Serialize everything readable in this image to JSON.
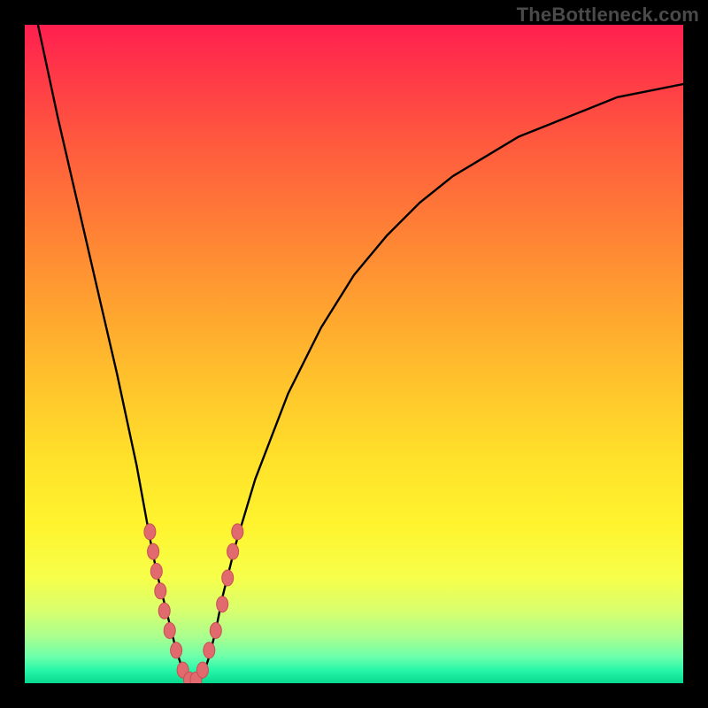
{
  "watermark": "TheBottleneck.com",
  "colors": {
    "background": "#000000",
    "gradient_top": "#ff1f4f",
    "gradient_bottom": "#07d88e",
    "curve": "#000000",
    "marker_fill": "#e06a6e",
    "marker_stroke": "#c94e54"
  },
  "chart_data": {
    "type": "line",
    "title": "",
    "xlabel": "",
    "ylabel": "",
    "xlim": [
      0,
      100
    ],
    "ylim": [
      0,
      100
    ],
    "grid": false,
    "legend": false,
    "series": [
      {
        "name": "bottleneck-curve",
        "x": [
          2,
          5,
          8,
          11,
          14,
          17,
          19,
          20,
          21,
          22,
          23,
          24,
          25,
          26,
          27,
          28,
          29,
          30,
          32,
          35,
          40,
          45,
          50,
          55,
          60,
          65,
          70,
          75,
          80,
          85,
          90,
          95,
          100
        ],
        "y": [
          100,
          86,
          73,
          60,
          47,
          33,
          22,
          17,
          13,
          9,
          5,
          2,
          0,
          0,
          1,
          4,
          8,
          13,
          21,
          31,
          44,
          54,
          62,
          68,
          73,
          77,
          80,
          83,
          85,
          87,
          89,
          90,
          91
        ]
      }
    ],
    "markers": [
      {
        "x": 19.0,
        "y": 23
      },
      {
        "x": 19.5,
        "y": 20
      },
      {
        "x": 20.0,
        "y": 17
      },
      {
        "x": 20.6,
        "y": 14
      },
      {
        "x": 21.2,
        "y": 11
      },
      {
        "x": 22.0,
        "y": 8
      },
      {
        "x": 23.0,
        "y": 5
      },
      {
        "x": 24.0,
        "y": 2
      },
      {
        "x": 25.0,
        "y": 0.5
      },
      {
        "x": 26.0,
        "y": 0.5
      },
      {
        "x": 27.0,
        "y": 2
      },
      {
        "x": 28.0,
        "y": 5
      },
      {
        "x": 29.0,
        "y": 8
      },
      {
        "x": 30.0,
        "y": 12
      },
      {
        "x": 30.8,
        "y": 16
      },
      {
        "x": 31.6,
        "y": 20
      },
      {
        "x": 32.3,
        "y": 23
      }
    ],
    "notes": "V-shaped bottleneck curve on rainbow gradient. X and Y values are read in percent of plot area; no axis tick labels are shown in the source image."
  }
}
